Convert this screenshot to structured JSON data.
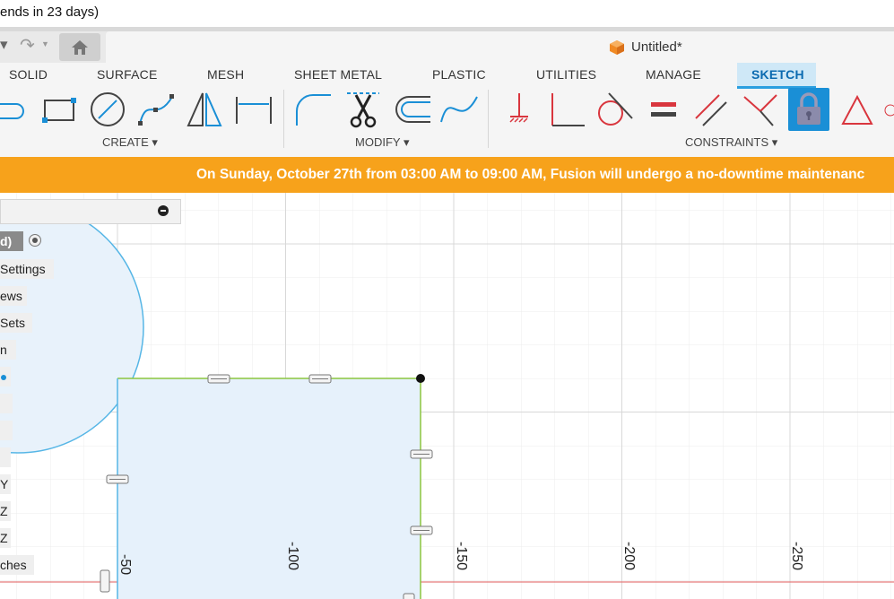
{
  "trial": {
    "text": "ends in 23 days)"
  },
  "document": {
    "title": "Untitled*"
  },
  "ribbon_tabs": [
    "SOLID",
    "SURFACE",
    "MESH",
    "SHEET METAL",
    "PLASTIC",
    "UTILITIES",
    "MANAGE",
    "SKETCH"
  ],
  "active_tab": "SKETCH",
  "groups": {
    "create": "CREATE",
    "modify": "MODIFY",
    "constraints": "CONSTRAINTS"
  },
  "tools": {
    "create": [
      "line-icon",
      "rectangle-icon",
      "circle-icon",
      "spline-icon",
      "mirror-triangle-icon",
      "dimension-icon"
    ],
    "modify": [
      "fillet-icon",
      "trim-icon",
      "offset-icon",
      "spline-edit-icon"
    ],
    "constraints": [
      "fix-icon",
      "perpendicular-icon",
      "tangent-icon",
      "equal-icon",
      "parallel-icon",
      "coincident-icon",
      "lock-icon",
      "triangle-icon"
    ]
  },
  "banner": {
    "text": "On Sunday, October 27th from 03:00 AM to 09:00 AM, Fusion will undergo a no-downtime maintenanc"
  },
  "browser": {
    "active_item": "d)",
    "items": [
      "Settings",
      "ews",
      "Sets",
      "n",
      "",
      "",
      "",
      "",
      "Y",
      "Z",
      "Z",
      "ches"
    ]
  },
  "axis": {
    "ticks": [
      "-50",
      "-100",
      "-150",
      "-200",
      "-250"
    ]
  },
  "colors": {
    "accent": "#2b9fe0",
    "banner": "#f7a21b",
    "sketch_tab_bg": "#cfe8f7",
    "constraint_red": "#d9363e",
    "profile_fill": "#e6f1fb",
    "line_blue": "#56b6e6",
    "line_green": "#8cc63f"
  }
}
